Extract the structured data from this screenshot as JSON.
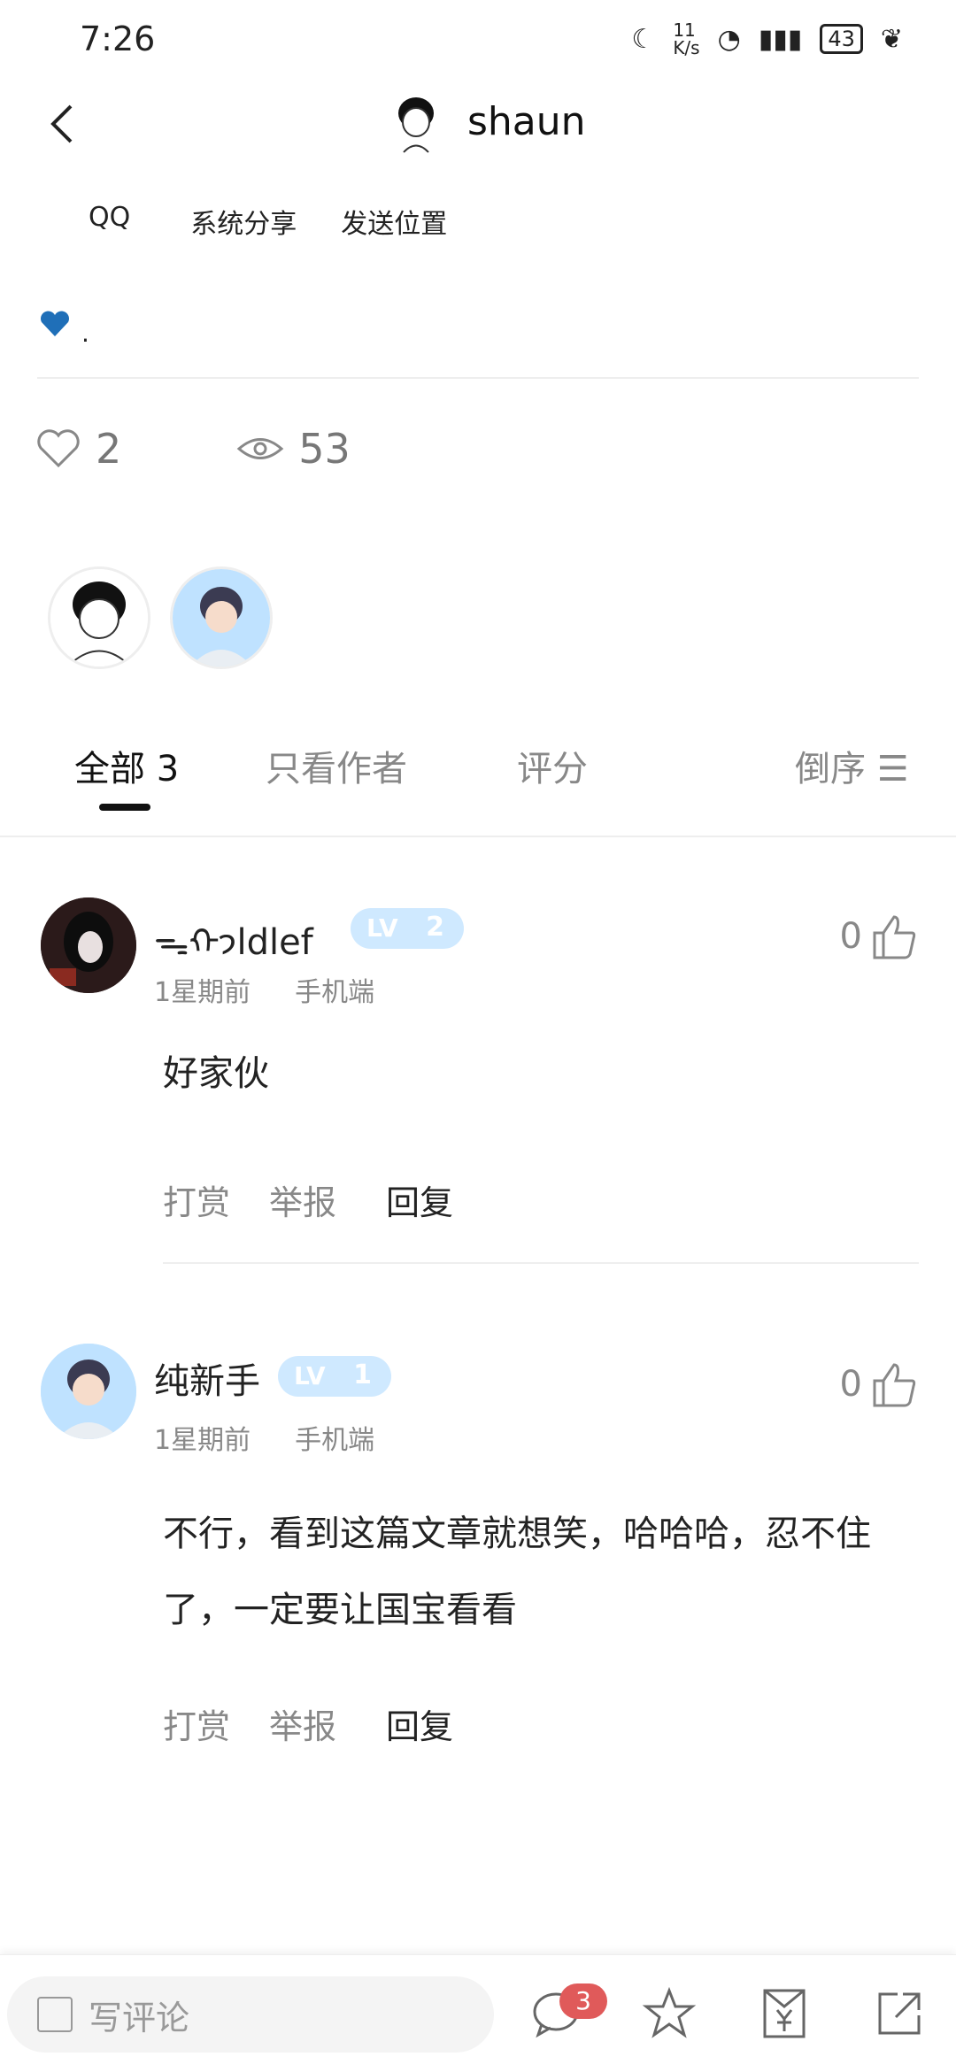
{
  "status_bar": {
    "time": "7:26",
    "network_speed": "11\nK/s",
    "battery": "43"
  },
  "header": {
    "user_name": "shaun",
    "share_actions": [
      "QQ",
      "系统分享",
      "发送位置"
    ]
  },
  "post": {
    "text": ".",
    "likes": "2",
    "views": "53"
  },
  "tabs": {
    "all": "全部 3",
    "author_only": "只看作者",
    "rating": "评分",
    "sort": "倒序"
  },
  "comments": [
    {
      "name": "ᯓᡣ𐭩ldlef",
      "level": "2",
      "time": "1星期前",
      "device": "手机端",
      "likes": "0",
      "body": "好家伙",
      "actions": [
        "打赏",
        "举报",
        "回复"
      ]
    },
    {
      "name": "纯新手",
      "level": "1",
      "time": "1星期前",
      "device": "手机端",
      "likes": "0",
      "body": "不行，看到这篇文章就想笑，哈哈哈，忍不住了，一定要让国宝看看",
      "actions": [
        "打赏",
        "举报",
        "回复"
      ]
    }
  ],
  "bottom_bar": {
    "comment_placeholder": "写评论",
    "comment_count": "3",
    "level_badge_text": "LV"
  },
  "colors": {
    "accent_badge": "#e05a5a",
    "level_badge": "#cfe9ff",
    "heart": "#1f6fb8"
  }
}
